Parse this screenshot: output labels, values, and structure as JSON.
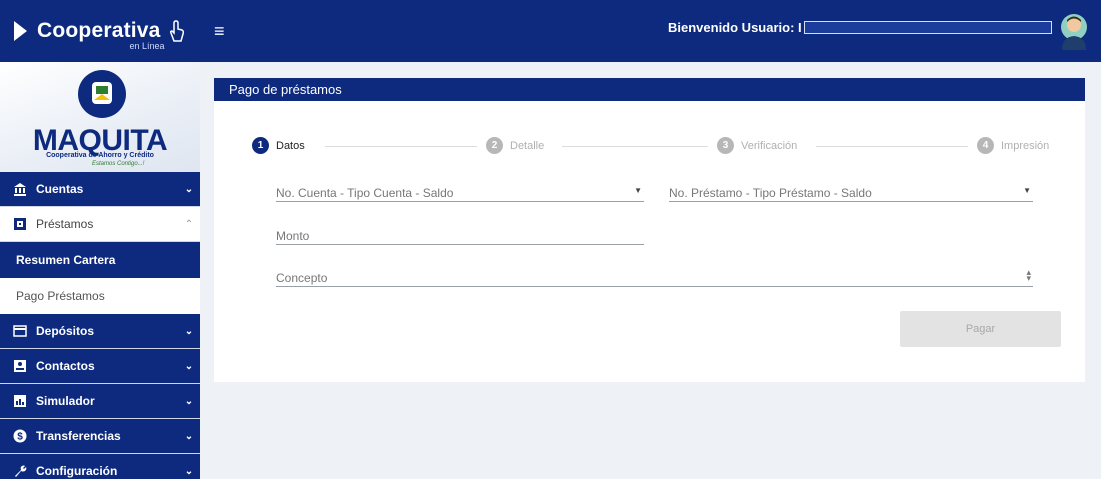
{
  "header": {
    "brand": "Cooperativa",
    "brand_sub": "en Línea",
    "welcome": "Bienvenido Usuario: I"
  },
  "logo": {
    "name": "MAQUITA",
    "sub1": "Cooperativa de Ahorro y Crédito",
    "sub2": "Estamos Contigo...!"
  },
  "sidebar": {
    "items": [
      {
        "label": "Cuentas",
        "icon": "bank-icon"
      },
      {
        "label": "Préstamos",
        "icon": "loan-icon"
      },
      {
        "label": "Resumen Cartera"
      },
      {
        "label": "Pago Préstamos"
      },
      {
        "label": "Depósitos",
        "icon": "card-icon"
      },
      {
        "label": "Contactos",
        "icon": "contacts-icon"
      },
      {
        "label": "Simulador",
        "icon": "chart-icon"
      },
      {
        "label": "Transferencias",
        "icon": "dollar-icon"
      },
      {
        "label": "Configuración",
        "icon": "wrench-icon"
      }
    ]
  },
  "main": {
    "title": "Pago de préstamos",
    "steps": [
      {
        "num": "1",
        "label": "Datos"
      },
      {
        "num": "2",
        "label": "Detalle"
      },
      {
        "num": "3",
        "label": "Verificación"
      },
      {
        "num": "4",
        "label": "Impresión"
      }
    ],
    "fields": {
      "account": "No. Cuenta - Tipo Cuenta - Saldo",
      "loan": "No. Préstamo - Tipo Préstamo - Saldo",
      "amount": "Monto",
      "concept": "Concepto"
    },
    "pay_label": "Pagar"
  },
  "colors": {
    "primary": "#0d2a7e",
    "background": "#eef1f5",
    "disabled_button": "#e3e3e3"
  }
}
